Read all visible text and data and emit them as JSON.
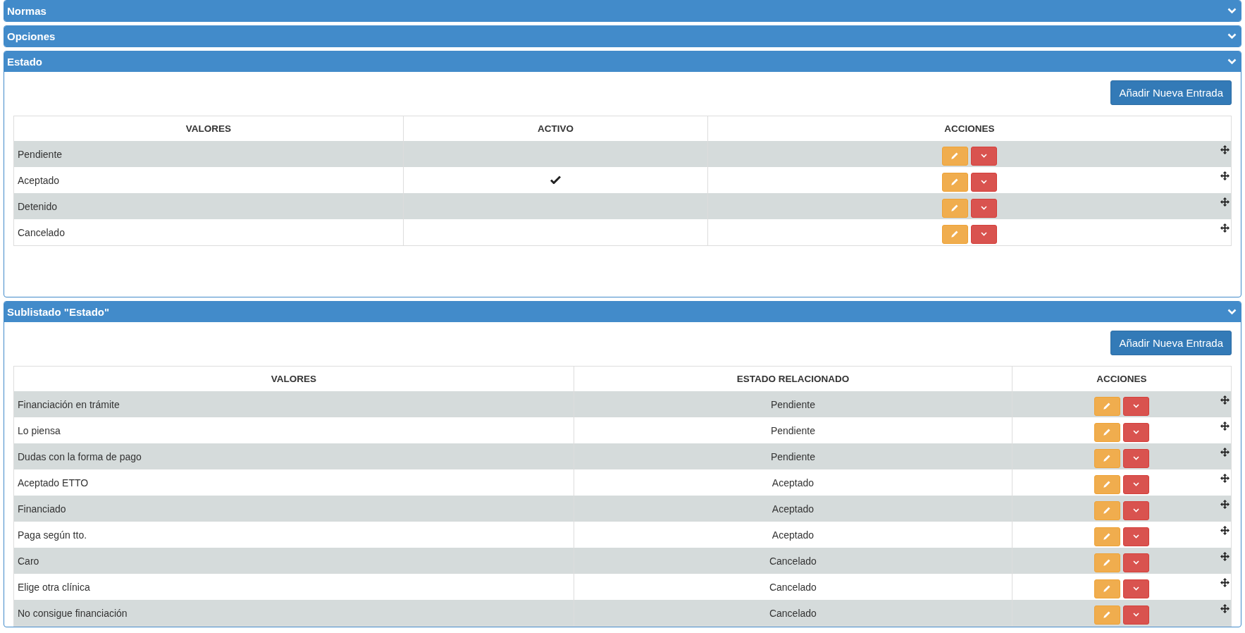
{
  "panels": [
    {
      "title": "Normas",
      "expanded": false
    },
    {
      "title": "Opciones",
      "expanded": false
    },
    {
      "title": "Estado",
      "expanded": true,
      "kind": "states",
      "add_button": "Añadir Nueva Entrada",
      "columns": [
        "VALORES",
        "ACTIVO",
        "ACCIONES"
      ],
      "rows": [
        {
          "value": "Pendiente",
          "active": false
        },
        {
          "value": "Aceptado",
          "active": true
        },
        {
          "value": "Detenido",
          "active": false
        },
        {
          "value": "Cancelado",
          "active": false
        }
      ]
    },
    {
      "title": "Sublistado \"Estado\"",
      "expanded": true,
      "kind": "substates",
      "add_button": "Añadir Nueva Entrada",
      "columns": [
        "VALORES",
        "ESTADO RELACIONADO",
        "ACCIONES"
      ],
      "rows": [
        {
          "value": "Financiación en trámite",
          "related": "Pendiente"
        },
        {
          "value": "Lo piensa",
          "related": "Pendiente"
        },
        {
          "value": "Dudas con la forma de pago",
          "related": "Pendiente"
        },
        {
          "value": "Aceptado ETTO",
          "related": "Aceptado"
        },
        {
          "value": "Financiado",
          "related": "Aceptado"
        },
        {
          "value": "Paga según tto.",
          "related": "Aceptado"
        },
        {
          "value": "Caro",
          "related": "Cancelado"
        },
        {
          "value": "Elige otra clínica",
          "related": "Cancelado"
        },
        {
          "value": "No consigue financiación",
          "related": "Cancelado"
        }
      ]
    }
  ]
}
